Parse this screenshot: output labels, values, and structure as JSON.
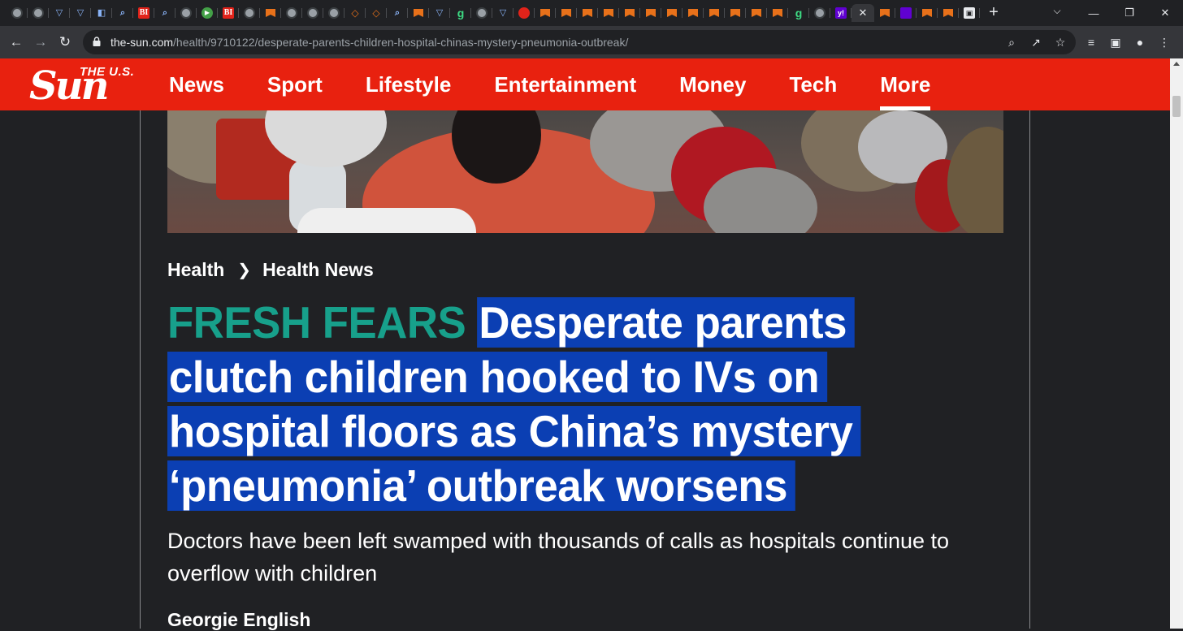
{
  "browser": {
    "tabs": [
      {
        "icon": "globe"
      },
      {
        "icon": "globe"
      },
      {
        "icon": "shield"
      },
      {
        "icon": "shield"
      },
      {
        "icon": "blue-d"
      },
      {
        "icon": "search"
      },
      {
        "icon": "bi"
      },
      {
        "icon": "search"
      },
      {
        "icon": "globe"
      },
      {
        "icon": "play"
      },
      {
        "icon": "bi"
      },
      {
        "icon": "globe"
      },
      {
        "icon": "orange-bookmark"
      },
      {
        "icon": "globe"
      },
      {
        "icon": "globe"
      },
      {
        "icon": "globe"
      },
      {
        "icon": "ublock"
      },
      {
        "icon": "ublock"
      },
      {
        "icon": "search"
      },
      {
        "icon": "orange-bookmark"
      },
      {
        "icon": "shield"
      },
      {
        "icon": "g"
      },
      {
        "icon": "globe"
      },
      {
        "icon": "shield"
      },
      {
        "icon": "red"
      },
      {
        "icon": "orange-bookmark"
      },
      {
        "icon": "orange-bookmark"
      },
      {
        "icon": "orange-bookmark"
      },
      {
        "icon": "orange-bookmark"
      },
      {
        "icon": "orange-bookmark"
      },
      {
        "icon": "orange-bookmark"
      },
      {
        "icon": "orange-bookmark"
      },
      {
        "icon": "orange-bookmark"
      },
      {
        "icon": "orange-bookmark"
      },
      {
        "icon": "orange-bookmark"
      },
      {
        "icon": "orange-bookmark"
      },
      {
        "icon": "orange-bookmark"
      },
      {
        "icon": "g"
      },
      {
        "icon": "globe"
      },
      {
        "icon": "yahoo"
      },
      {
        "icon": "close",
        "active": true
      },
      {
        "icon": "orange-bookmark"
      },
      {
        "icon": "mail"
      },
      {
        "icon": "orange-bookmark"
      },
      {
        "icon": "orange-bookmark"
      },
      {
        "icon": "mono"
      }
    ],
    "address": {
      "host": "the-sun.com",
      "path": "/health/9710122/desperate-parents-children-hospital-chinas-mystery-pneumonia-outbreak/"
    },
    "icons": {
      "back": "back-arrow-icon",
      "forward": "forward-arrow-icon",
      "reload": "reload-icon",
      "zoom": "zoom-icon",
      "share": "share-icon",
      "bookmark": "star-icon",
      "media": "media-control-icon",
      "sidepanel": "side-panel-icon",
      "profile": "profile-icon",
      "menu": "kebab-menu-icon"
    }
  },
  "site": {
    "logo_top": "THE U.S.",
    "logo_main": "Sun",
    "brand_color": "#e8210f",
    "nav": [
      {
        "label": "News"
      },
      {
        "label": "Sport"
      },
      {
        "label": "Lifestyle"
      },
      {
        "label": "Entertainment"
      },
      {
        "label": "Money"
      },
      {
        "label": "Tech"
      },
      {
        "label": "More",
        "active": true
      }
    ]
  },
  "article": {
    "breadcrumb": [
      "Health",
      "Health News"
    ],
    "kicker": "FRESH FEARS",
    "kicker_color": "#17a08b",
    "headline": "Desperate parents clutch children hooked to IVs on hospital floors as China’s mystery ‘pneumonia’ outbreak worsens",
    "headline_selected": true,
    "selection_color": "#0b3fb3",
    "standfirst": "Doctors have been left swamped with thousands of calls as hospitals continue to overflow with children",
    "byline": "Georgie English"
  }
}
